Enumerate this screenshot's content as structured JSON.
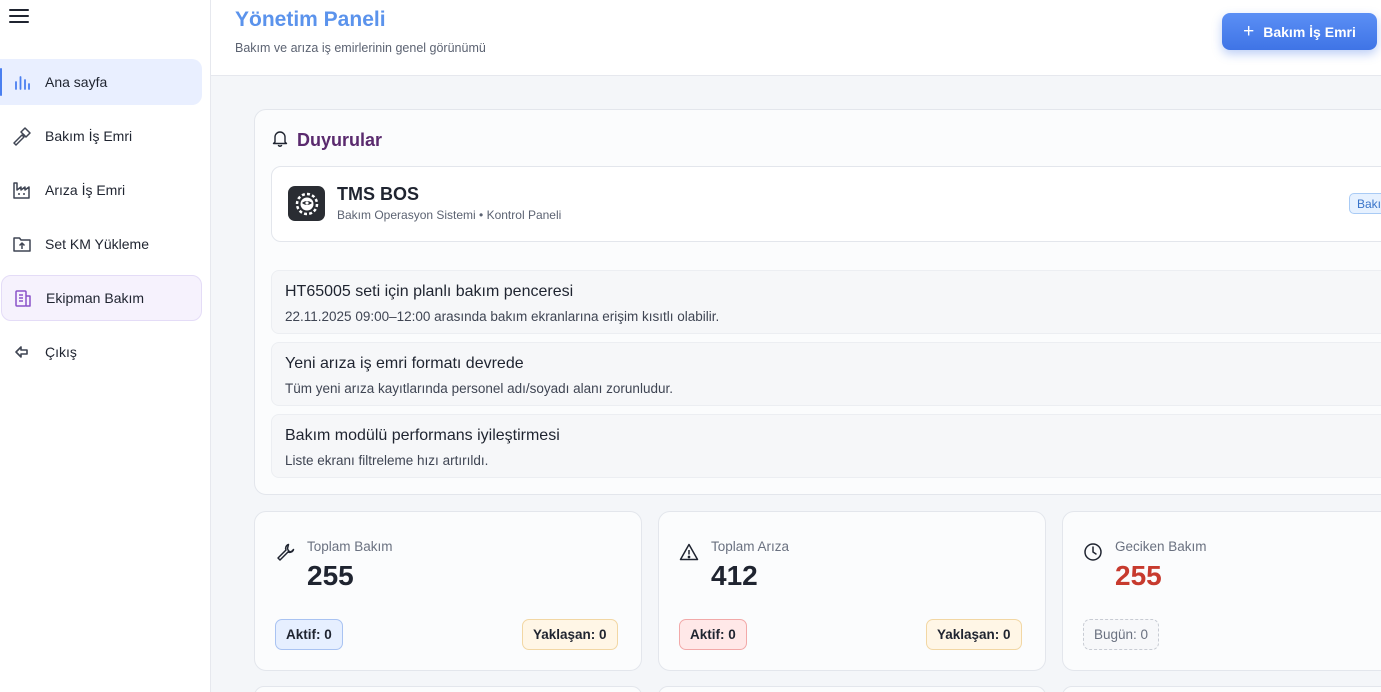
{
  "sidebar": {
    "items": [
      {
        "label": "Ana sayfa"
      },
      {
        "label": "Bakım İş Emri"
      },
      {
        "label": "Arıza İş Emri"
      },
      {
        "label": "Set KM Yükleme"
      },
      {
        "label": "Ekipman Bakım"
      },
      {
        "label": "Çıkış"
      }
    ]
  },
  "header": {
    "title": "Yönetim Paneli",
    "subtitle": "Bakım ve arıza iş emirlerinin genel görünümü",
    "primary_button": "Bakım İş Emri"
  },
  "announcements": {
    "title": "Duyurular",
    "brand": {
      "name": "TMS BOS",
      "subtitle": "Bakım Operasyon Sistemi • Kontrol Paneli",
      "badge": "Bakı"
    },
    "items": [
      {
        "title": "HT65005 seti için planlı bakım penceresi",
        "text": "22.11.2025 09:00–12:00 arasında bakım ekranlarına erişim kısıtlı olabilir."
      },
      {
        "title": "Yeni arıza iş emri formatı devrede",
        "text": "Tüm yeni arıza kayıtlarında personel adı/soyadı alanı zorunludur."
      },
      {
        "title": "Bakım modülü performans iyileştirmesi",
        "text": "Liste ekranı filtreleme hızı artırıldı."
      }
    ]
  },
  "stats": [
    {
      "label": "Toplam Bakım",
      "value": "255",
      "left_pill": "Aktif: 0",
      "right_pill": "Yaklaşan: 0",
      "icon": "wrench-icon"
    },
    {
      "label": "Toplam Arıza",
      "value": "412",
      "left_pill": "Aktif: 0",
      "right_pill": "Yaklaşan: 0",
      "icon": "warning-icon"
    },
    {
      "label": "Geciken Bakım",
      "value": "255",
      "left_pill": "Bugün: 0",
      "icon": "clock-icon"
    }
  ],
  "colors": {
    "accent": "#5b93ec",
    "primary_button": "#4a7ff0",
    "announce_title": "#5a2a6e",
    "danger": "#c73a2e"
  }
}
